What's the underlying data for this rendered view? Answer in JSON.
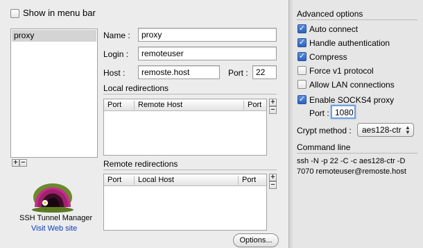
{
  "main": {
    "show_in_menu_bar": {
      "label": "Show in menu bar",
      "checked": false
    },
    "tunnels": [
      "proxy"
    ],
    "selected_tunnel": "proxy",
    "form": {
      "name_label": "Name :",
      "name_value": "proxy",
      "login_label": "Login :",
      "login_value": "remoteuser",
      "host_label": "Host :",
      "host_value": "remoste.host",
      "port_label": "Port :",
      "port_value": "22"
    },
    "local_redirections": {
      "title": "Local redirections",
      "columns": [
        "Port",
        "Remote Host",
        "Port"
      ]
    },
    "remote_redirections": {
      "title": "Remote redirections",
      "columns": [
        "Port",
        "Local Host",
        "Port"
      ]
    },
    "add_symbol": "+",
    "remove_symbol": "−",
    "app_name": "SSH Tunnel Manager",
    "visit_link": "Visit Web site",
    "options_button": "Options..."
  },
  "drawer": {
    "advanced_title": "Advanced options",
    "options": [
      {
        "label": "Auto connect",
        "checked": true
      },
      {
        "label": "Handle authentication",
        "checked": true
      },
      {
        "label": "Compress",
        "checked": true
      },
      {
        "label": "Force v1 protocol",
        "checked": false
      },
      {
        "label": "Allow LAN connections",
        "checked": false
      },
      {
        "label": "Enable SOCKS4 proxy",
        "checked": true
      }
    ],
    "socks_port_label": "Port :",
    "socks_port_value": "1080",
    "crypt_label": "Crypt method :",
    "crypt_value": "aes128-ctr",
    "command_title": "Command line",
    "command_line": "ssh -N -p 22 -C -c aes128-ctr -D 7070 remoteuser@remoste.host"
  },
  "colors": {
    "window_bg": "#ececec",
    "drawer_bg": "#e6e6e6",
    "checkbox_blue": "#2a63c2",
    "link_blue": "#0b3cc1",
    "selection_gray": "#d4d4d4"
  }
}
